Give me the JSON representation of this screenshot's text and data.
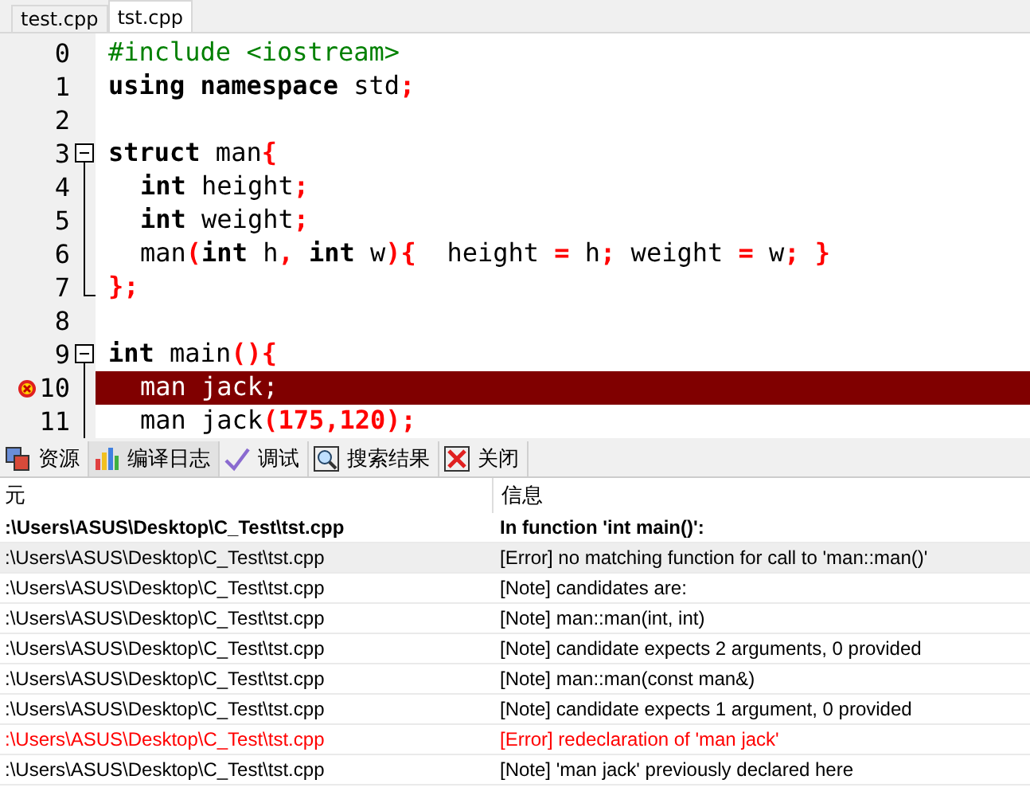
{
  "file_tabs": [
    {
      "label": "test.cpp",
      "selected": false
    },
    {
      "label": "tst.cpp",
      "selected": true
    }
  ],
  "editor": {
    "lines": [
      {
        "number": "0",
        "kind": "plain",
        "tokens": [
          {
            "text": "#include <iostream>",
            "kind": "preproc"
          }
        ]
      },
      {
        "number": "1",
        "kind": "plain",
        "tokens": [
          {
            "text": "using namespace",
            "kind": "keyword"
          },
          {
            "text": " std",
            "kind": "ident"
          },
          {
            "text": ";",
            "kind": "symbol"
          }
        ]
      },
      {
        "number": "2",
        "kind": "plain"
      },
      {
        "number": "3",
        "kind": "fold_start",
        "tokens": [
          {
            "text": "struct",
            "kind": "keyword"
          },
          {
            "text": " man",
            "kind": "ident"
          },
          {
            "text": "{",
            "kind": "symbol"
          }
        ]
      },
      {
        "number": "4",
        "kind": "fold_inner",
        "indent": true,
        "tokens": [
          {
            "text": "int",
            "kind": "keyword"
          },
          {
            "text": " height",
            "kind": "ident"
          },
          {
            "text": ";",
            "kind": "symbol"
          }
        ]
      },
      {
        "number": "5",
        "kind": "fold_inner",
        "indent": true,
        "tokens": [
          {
            "text": "int",
            "kind": "keyword"
          },
          {
            "text": " weight",
            "kind": "ident"
          },
          {
            "text": ";",
            "kind": "symbol"
          }
        ]
      },
      {
        "number": "6",
        "kind": "fold_inner",
        "indent": true,
        "tokens": [
          {
            "text": "man",
            "kind": "ident"
          },
          {
            "text": "(",
            "kind": "symbol"
          },
          {
            "text": "int",
            "kind": "keyword"
          },
          {
            "text": " h",
            "kind": "ident"
          },
          {
            "text": ", ",
            "kind": "symbol"
          },
          {
            "text": "int",
            "kind": "keyword"
          },
          {
            "text": " w",
            "kind": "ident"
          },
          {
            "text": "){",
            "kind": "symbol"
          },
          {
            "text": "  height ",
            "kind": "ident"
          },
          {
            "text": "=",
            "kind": "symbol"
          },
          {
            "text": " h",
            "kind": "ident"
          },
          {
            "text": ";",
            "kind": "symbol"
          },
          {
            "text": " weight ",
            "kind": "ident"
          },
          {
            "text": "=",
            "kind": "symbol"
          },
          {
            "text": " w",
            "kind": "ident"
          },
          {
            "text": "; }",
            "kind": "symbol"
          }
        ]
      },
      {
        "number": "7",
        "kind": "fold_end",
        "tokens": [
          {
            "text": "};",
            "kind": "symbol"
          }
        ]
      },
      {
        "number": "8",
        "kind": "plain"
      },
      {
        "number": "9",
        "kind": "fold_start",
        "tokens": [
          {
            "text": "int",
            "kind": "keyword"
          },
          {
            "text": " main",
            "kind": "ident"
          },
          {
            "text": "(){",
            "kind": "symbol"
          }
        ]
      },
      {
        "number": "10",
        "kind": "fold_inner",
        "indent": true,
        "highlighted": true,
        "error_mark": true,
        "tokens": [
          {
            "text": "man jack;",
            "kind": "ident"
          }
        ]
      },
      {
        "number": "11",
        "kind": "fold_inner",
        "indent": true,
        "tokens": [
          {
            "text": "man jack",
            "kind": "ident"
          },
          {
            "text": "(175,120);",
            "kind": "symbol"
          }
        ]
      }
    ]
  },
  "panel_tabs": [
    {
      "label": "资源",
      "selected": false
    },
    {
      "label": "编译日志",
      "selected": true
    },
    {
      "label": "调试",
      "selected": false
    },
    {
      "label": "搜索结果",
      "selected": false
    },
    {
      "label": "关闭",
      "selected": false
    }
  ],
  "table": {
    "columns": [
      "元",
      "信息"
    ],
    "rows": [
      {
        "unit": ":\\Users\\ASUS\\Desktop\\C_Test\\tst.cpp",
        "message": "In function 'int main()':",
        "kind": "heading",
        "selected": false
      },
      {
        "unit": ":\\Users\\ASUS\\Desktop\\C_Test\\tst.cpp",
        "message": "[Error] no matching function for call to 'man::man()'",
        "kind": "message",
        "selected": true
      },
      {
        "unit": ":\\Users\\ASUS\\Desktop\\C_Test\\tst.cpp",
        "message": "[Note] candidates are:",
        "kind": "message",
        "selected": false
      },
      {
        "unit": ":\\Users\\ASUS\\Desktop\\C_Test\\tst.cpp",
        "message": "[Note] man::man(int, int)",
        "kind": "message",
        "selected": false
      },
      {
        "unit": ":\\Users\\ASUS\\Desktop\\C_Test\\tst.cpp",
        "message": "[Note] candidate expects 2 arguments, 0 provided",
        "kind": "message",
        "selected": false
      },
      {
        "unit": ":\\Users\\ASUS\\Desktop\\C_Test\\tst.cpp",
        "message": "[Note] man::man(const man&)",
        "kind": "message",
        "selected": false
      },
      {
        "unit": ":\\Users\\ASUS\\Desktop\\C_Test\\tst.cpp",
        "message": "[Note] candidate expects 1 argument, 0 provided",
        "kind": "message",
        "selected": false
      },
      {
        "unit": ":\\Users\\ASUS\\Desktop\\C_Test\\tst.cpp",
        "message": "[Error] redeclaration of 'man jack'",
        "kind": "error",
        "selected": false
      },
      {
        "unit": ":\\Users\\ASUS\\Desktop\\C_Test\\tst.cpp",
        "message": "[Note] 'man jack' previously declared here",
        "kind": "message",
        "selected": false
      }
    ]
  }
}
